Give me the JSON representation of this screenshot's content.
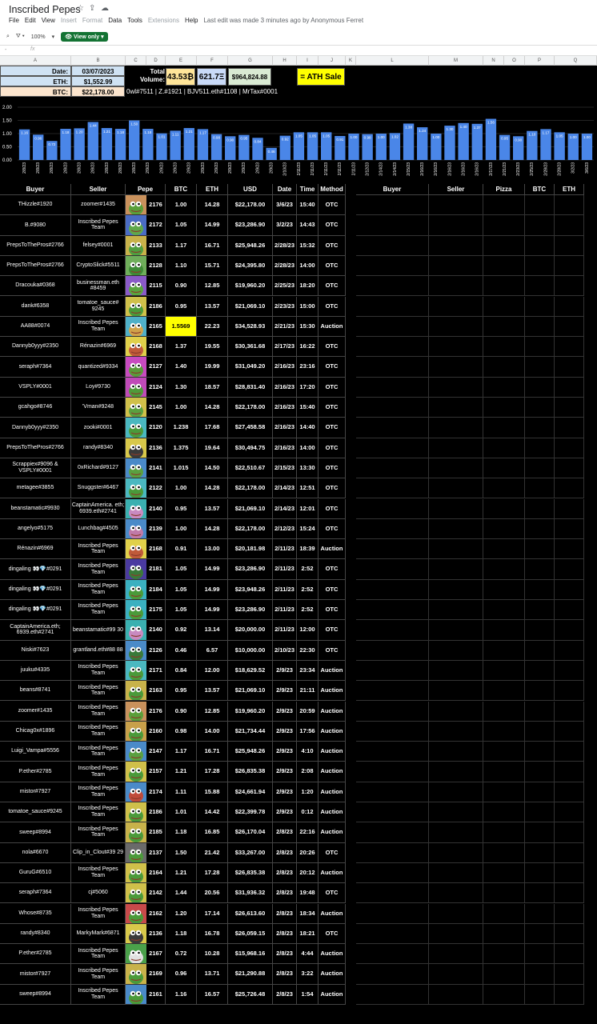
{
  "app": {
    "title": "Inscribed Pepes",
    "menus": [
      "File",
      "Edit",
      "View",
      "Insert",
      "Format",
      "Data",
      "Tools",
      "Extensions",
      "Help"
    ],
    "disabled_menus": [
      "Insert",
      "Format",
      "Extensions"
    ],
    "last_edit": "Last edit was made 3 minutes ago by Anonymous Ferret",
    "zoom": "100%",
    "view_only_label": "View only",
    "fx_label": "fx",
    "cell_ref": "-"
  },
  "columns": [
    "A",
    "B",
    "C",
    "D",
    "E",
    "F",
    "G",
    "H",
    "I",
    "J",
    "K",
    "L",
    "M",
    "N",
    "O",
    "P",
    "Q"
  ],
  "summary": {
    "date_label": "Date:",
    "date_value": "03/07/2023",
    "eth_label": "ETH:",
    "eth_value": "$1,552.99",
    "btc_label": "BTC:",
    "btc_value": "$22,178.00",
    "total_label": "Total Volume:",
    "total_btc": "43.53₿",
    "total_eth": "621.7Ξ",
    "total_usd": "$964,824.88",
    "ath_label": "= ATH Sale",
    "credits": "0wl#7511 | Z.#1921 | BJV511.eth#1108 | MrTax#0001",
    "colors": {
      "date_bg": "#cfe2f3",
      "btc_bg": "#fce5cd",
      "total_btc_bg": "#ffe599",
      "total_eth_bg": "#c9daf8",
      "total_usd_bg": "#d9ead3",
      "ath_bg": "#ffff00"
    }
  },
  "chart_data": {
    "type": "bar",
    "color": "#4a86e8",
    "ylim": [
      0,
      2.0
    ],
    "yticks": [
      "2.00",
      "1.50",
      "1.00",
      "0.50",
      "0.00"
    ],
    "categories": [
      "2/8/23",
      "2/8/23",
      "2/8/23",
      "2/8/23",
      "2/8/23",
      "2/8/23",
      "2/8/23",
      "2/8/23",
      "2/8/23",
      "2/9/23",
      "2/9/23",
      "2/9/23",
      "2/9/23",
      "2/9/23",
      "2/9/23",
      "2/9/23",
      "2/9/23",
      "2/9/23",
      "2/9/23",
      "2/10/23",
      "2/11/23",
      "2/11/23",
      "2/11/23",
      "2/11/23",
      "2/11/23",
      "2/12/23",
      "2/14/23",
      "2/14/23",
      "2/15/23",
      "2/16/23",
      "2/16/23",
      "2/16/23",
      "2/16/23",
      "2/16/23",
      "2/17/23",
      "2/21/23",
      "2/23/23",
      "2/25/23",
      "2/28/23",
      "2/28/23",
      "3/2/23",
      "3/6/23"
    ],
    "values": [
      1.16,
      0.96,
      0.72,
      1.18,
      1.2,
      1.44,
      1.21,
      1.18,
      1.5,
      1.18,
      1.01,
      1.11,
      1.21,
      1.17,
      0.98,
      0.9,
      0.95,
      0.84,
      0.46,
      0.92,
      1.05,
      1.05,
      1.05,
      0.91,
      1.0,
      0.98,
      1.0,
      1.02,
      1.38,
      1.24,
      1.0,
      1.3,
      1.4,
      1.37,
      1.56,
      0.95,
      0.9,
      1.1,
      1.17,
      1.05,
      1.0,
      1.0
    ],
    "labels": [
      "1.16",
      "0.96",
      "0.72",
      "1.18",
      "1.20",
      "1.44",
      "1.21",
      "1.18",
      "1.50",
      "1.18",
      "1.01",
      "1.11",
      "1.21",
      "1.17",
      "0.98",
      "0.90",
      "0.95",
      "0.84",
      "0.46",
      "0.92",
      "1.05",
      "1.05",
      "1.05",
      "0.91",
      "1.00",
      "0.98",
      "1.00",
      "1.02",
      "1.38",
      "1.24",
      "1.00",
      "1.30",
      "1.40",
      "1.37",
      "1.56",
      "0.95",
      "0.90",
      "1.10",
      "1.17",
      "1.05",
      "1.00",
      "1.00"
    ]
  },
  "table": {
    "headers": [
      "Buyer",
      "Seller",
      "Pepe",
      "BTC",
      "ETH",
      "USD",
      "Date",
      "Time",
      "Method"
    ],
    "right_headers": [
      "Buyer",
      "Seller",
      "Pizza",
      "BTC",
      "ETH"
    ],
    "rows": [
      {
        "buyer": "THizzle#1920",
        "seller": "zoomer#1435",
        "pepe": "2176",
        "btc": "1.00",
        "eth": "14.28",
        "usd": "$22,178.00",
        "date": "3/6/23",
        "time": "15:40",
        "method": "OTC",
        "bg": "#c9915c",
        "fg": "#5a9f3a"
      },
      {
        "buyer": "B.#9080",
        "seller": "Inscribed Pepes Team",
        "pepe": "2172",
        "btc": "1.05",
        "eth": "14.99",
        "usd": "$23,286.90",
        "date": "3/2/23",
        "time": "14:43",
        "method": "OTC",
        "bg": "#4a6cc4",
        "fg": "#5fa84a"
      },
      {
        "buyer": "PrepsToThePros#2766",
        "seller": "felsey#0001",
        "pepe": "2133",
        "btc": "1.17",
        "eth": "16.71",
        "usd": "$25,948.26",
        "date": "2/28/23",
        "time": "15:32",
        "method": "OTC",
        "bg": "#c8b24a",
        "fg": "#4f9e3f"
      },
      {
        "buyer": "PrepsToThePros#2766",
        "seller": "CryptoSlick#5511",
        "pepe": "2128",
        "btc": "1.10",
        "eth": "15.71",
        "usd": "$24,395.80",
        "date": "2/28/23",
        "time": "14:00",
        "method": "OTC",
        "bg": "#6fae5a",
        "fg": "#3e8a36"
      },
      {
        "buyer": "Dracouka#0368",
        "seller": "businessman.eth #8459",
        "pepe": "2115",
        "btc": "0.90",
        "eth": "12.85",
        "usd": "$19,960.20",
        "date": "2/25/23",
        "time": "18:20",
        "method": "OTC",
        "bg": "#8a5ac8",
        "fg": "#59a43f"
      },
      {
        "buyer": "dank#6358",
        "seller": "tomatoe_sauce# 9245",
        "pepe": "2186",
        "btc": "0.95",
        "eth": "13.57",
        "usd": "$21,069.10",
        "date": "2/23/23",
        "time": "15:00",
        "method": "OTC",
        "bg": "#cfc04a",
        "fg": "#4a9a3a"
      },
      {
        "buyer": "AA88#0074",
        "seller": "Inscribed Pepes Team",
        "pepe": "2165",
        "btc": "1.5569",
        "eth": "22.23",
        "usd": "$34,528.93",
        "date": "2/21/23",
        "time": "15:30",
        "method": "Auction",
        "bg": "#4fb0c8",
        "fg": "#d0a24a",
        "ath": true
      },
      {
        "buyer": "Dannyb0yyy#2350",
        "seller": "Rénazin#6969",
        "pepe": "2168",
        "btc": "1.37",
        "eth": "19.55",
        "usd": "$30,361.68",
        "date": "2/17/23",
        "time": "16:22",
        "method": "OTC",
        "bg": "#e0d04a",
        "fg": "#c05a3a"
      },
      {
        "buyer": "seraph#7364",
        "seller": "quantized#9334",
        "pepe": "2127",
        "btc": "1.40",
        "eth": "19.99",
        "usd": "$31,049.20",
        "date": "2/16/23",
        "time": "23:16",
        "method": "OTC",
        "bg": "#c84ac0",
        "fg": "#5a9a3a"
      },
      {
        "buyer": "VSPLY#0001",
        "seller": "Loy#9730",
        "pepe": "2124",
        "btc": "1.30",
        "eth": "18.57",
        "usd": "$28,831.40",
        "date": "2/16/23",
        "time": "17:20",
        "method": "OTC",
        "bg": "#c04ab8",
        "fg": "#4f9a3a"
      },
      {
        "buyer": "gcahgo#8746",
        "seller": "'Vman#9248",
        "pepe": "2145",
        "btc": "1.00",
        "eth": "14.28",
        "usd": "$22,178.00",
        "date": "2/16/23",
        "time": "15:40",
        "method": "OTC",
        "bg": "#d0c04a",
        "fg": "#5aa040"
      },
      {
        "buyer": "Dannyb0yyy#2350",
        "seller": "zooki#0001",
        "pepe": "2120",
        "btc": "1.238",
        "eth": "17.68",
        "usd": "$27,458.58",
        "date": "2/16/23",
        "time": "14:40",
        "method": "OTC",
        "bg": "#4ab8c0",
        "fg": "#4a9a3a"
      },
      {
        "buyer": "PrepsToThePros#2766",
        "seller": "randy#8340",
        "pepe": "2136",
        "btc": "1.375",
        "eth": "19.64",
        "usd": "$30,494.75",
        "date": "2/16/23",
        "time": "14:00",
        "method": "OTC",
        "bg": "#d8c84a",
        "fg": "#3a3a3a"
      },
      {
        "buyer": "Scrappiex#9096 & VSPLY#0001",
        "seller": "0xRichard#9127",
        "pepe": "2141",
        "btc": "1.015",
        "eth": "14.50",
        "usd": "$22,510.67",
        "date": "2/15/23",
        "time": "13:30",
        "method": "OTC",
        "bg": "#4a8ac8",
        "fg": "#5aa040"
      },
      {
        "buyer": "metagee#3855",
        "seller": "Snuggster#6467",
        "pepe": "2122",
        "btc": "1.00",
        "eth": "14.28",
        "usd": "$22,178.00",
        "date": "2/14/23",
        "time": "12:51",
        "method": "OTC",
        "bg": "#4ab8c0",
        "fg": "#4a9a3a"
      },
      {
        "buyer": "beanstamatic#9930",
        "seller": "CaptainAmerica. eth; 6939.eth#2741",
        "pepe": "2140",
        "btc": "0.95",
        "eth": "13.57",
        "usd": "$21,069.10",
        "date": "2/14/23",
        "time": "12:01",
        "method": "OTC",
        "bg": "#3ab0b0",
        "fg": "#c88ac0"
      },
      {
        "buyer": "angelyo#5175",
        "seller": "Lunchbag#4505",
        "pepe": "2139",
        "btc": "1.00",
        "eth": "14.28",
        "usd": "$22,178.00",
        "date": "2/12/23",
        "time": "15:24",
        "method": "OTC",
        "bg": "#4a8ac8",
        "fg": "#c07aa8"
      },
      {
        "buyer": "Rénazin#6969",
        "seller": "Inscribed Pepes Team",
        "pepe": "2168",
        "btc": "0.91",
        "eth": "13.00",
        "usd": "$20,181.98",
        "date": "2/11/23",
        "time": "18:39",
        "method": "Auction",
        "bg": "#e0d04a",
        "fg": "#c05a3a"
      },
      {
        "buyer": "dingaling 👀💎#0291",
        "seller": "Inscribed Pepes Team",
        "pepe": "2181",
        "btc": "1.05",
        "eth": "14.99",
        "usd": "$23,286.90",
        "date": "2/11/23",
        "time": "2:52",
        "method": "OTC",
        "bg": "#4a3aa0",
        "fg": "#3a7a3a"
      },
      {
        "buyer": "dingaling 👀💎#0291",
        "seller": "Inscribed Pepes Team",
        "pepe": "2184",
        "btc": "1.05",
        "eth": "14.99",
        "usd": "$23,948.26",
        "date": "2/11/23",
        "time": "2:52",
        "method": "OTC",
        "bg": "#3ab0c0",
        "fg": "#4a9a3a"
      },
      {
        "buyer": "dingaling 👀💎#0291",
        "seller": "Inscribed Pepes Team",
        "pepe": "2175",
        "btc": "1.05",
        "eth": "14.99",
        "usd": "$23,286.90",
        "date": "2/11/23",
        "time": "2:52",
        "method": "OTC",
        "bg": "#3ab0c0",
        "fg": "#4a9a3a"
      },
      {
        "buyer": "CaptainAmerica.eth; 6939.eth#2741",
        "seller": "beanstamatic#99 30",
        "pepe": "2140",
        "btc": "0.92",
        "eth": "13.14",
        "usd": "$20,000.00",
        "date": "2/11/23",
        "time": "12:00",
        "method": "OTC",
        "bg": "#3ab0b0",
        "fg": "#c88ac0"
      },
      {
        "buyer": "Niski#7623",
        "seller": "grantland.eth#88 88",
        "pepe": "2126",
        "btc": "0.46",
        "eth": "6.57",
        "usd": "$10,000.00",
        "date": "2/10/23",
        "time": "22:30",
        "method": "OTC",
        "bg": "#4a8ac8",
        "fg": "#3a7a3a"
      },
      {
        "buyer": "juuku#4335",
        "seller": "Inscribed Pepes Team",
        "pepe": "2171",
        "btc": "0.84",
        "eth": "12.00",
        "usd": "$18,629.52",
        "date": "2/9/23",
        "time": "23:34",
        "method": "Auction",
        "bg": "#4ab8c0",
        "fg": "#4a9a3a"
      },
      {
        "buyer": "beans#8741",
        "seller": "Inscribed Pepes Team",
        "pepe": "2163",
        "btc": "0.95",
        "eth": "13.57",
        "usd": "$21,069.10",
        "date": "2/9/23",
        "time": "21:11",
        "method": "Auction",
        "bg": "#c8b24a",
        "fg": "#4a9a3a"
      },
      {
        "buyer": "zoomer#1435",
        "seller": "Inscribed Pepes Team",
        "pepe": "2176",
        "btc": "0.90",
        "eth": "12.85",
        "usd": "$19,960.20",
        "date": "2/9/23",
        "time": "20:59",
        "method": "Auction",
        "bg": "#c9915c",
        "fg": "#5a9f3a"
      },
      {
        "buyer": "Chicag0x#1896",
        "seller": "Inscribed Pepes Team",
        "pepe": "2160",
        "btc": "0.98",
        "eth": "14.00",
        "usd": "$21,734.44",
        "date": "2/9/23",
        "time": "17:56",
        "method": "Auction",
        "bg": "#c8a04a",
        "fg": "#4a9a3a"
      },
      {
        "buyer": "Luigi_Vampa#5556",
        "seller": "Inscribed Pepes Team",
        "pepe": "2147",
        "btc": "1.17",
        "eth": "16.71",
        "usd": "$25,948.26",
        "date": "2/9/23",
        "time": "4:10",
        "method": "Auction",
        "bg": "#4a8ac8",
        "fg": "#5aa040"
      },
      {
        "buyer": "P.ether#2785",
        "seller": "Inscribed Pepes Team",
        "pepe": "2157",
        "btc": "1.21",
        "eth": "17.28",
        "usd": "$26,835.38",
        "date": "2/9/23",
        "time": "2:08",
        "method": "Auction",
        "bg": "#d0c04a",
        "fg": "#4a9a3a"
      },
      {
        "buyer": "mistor#7927",
        "seller": "Inscribed Pepes Team",
        "pepe": "2174",
        "btc": "1.11",
        "eth": "15.88",
        "usd": "$24,661.94",
        "date": "2/9/23",
        "time": "1:20",
        "method": "Auction",
        "bg": "#4a8ac8",
        "fg": "#c04a3a"
      },
      {
        "buyer": "tomatoe_sauce#9245",
        "seller": "Inscribed Pepes Team",
        "pepe": "2186",
        "btc": "1.01",
        "eth": "14.42",
        "usd": "$22,399.78",
        "date": "2/9/23",
        "time": "0:12",
        "method": "Auction",
        "bg": "#cfc04a",
        "fg": "#4a9a3a"
      },
      {
        "buyer": "sweep#8994",
        "seller": "Inscribed Pepes Team",
        "pepe": "2185",
        "btc": "1.18",
        "eth": "16.85",
        "usd": "$26,170.04",
        "date": "2/8/23",
        "time": "22:16",
        "method": "Auction",
        "bg": "#c8b24a",
        "fg": "#4a9a3a"
      },
      {
        "buyer": "nola#6670",
        "seller": "Clip_in_Clout#39 29",
        "pepe": "2137",
        "btc": "1.50",
        "eth": "21.42",
        "usd": "$33,267.00",
        "date": "2/8/23",
        "time": "20:26",
        "method": "OTC",
        "bg": "#6a6a6a",
        "fg": "#4a9a3a"
      },
      {
        "buyer": "GuruG#6510",
        "seller": "Inscribed Pepes Team",
        "pepe": "2164",
        "btc": "1.21",
        "eth": "17.28",
        "usd": "$26,835.38",
        "date": "2/8/23",
        "time": "20:12",
        "method": "Auction",
        "bg": "#d0c04a",
        "fg": "#4a9a3a"
      },
      {
        "buyer": "seraph#7364",
        "seller": "cj#5060",
        "pepe": "2142",
        "btc": "1.44",
        "eth": "20.56",
        "usd": "$31,936.32",
        "date": "2/8/23",
        "time": "19:48",
        "method": "OTC",
        "bg": "#d0c04a",
        "fg": "#4a9a3a"
      },
      {
        "buyer": "Whose#8735",
        "seller": "Inscribed Pepes Team",
        "pepe": "2162",
        "btc": "1.20",
        "eth": "17.14",
        "usd": "$26,613.60",
        "date": "2/8/23",
        "time": "18:34",
        "method": "Auction",
        "bg": "#c84a4a",
        "fg": "#4a9a3a"
      },
      {
        "buyer": "randy#8340",
        "seller": "MarkyMark#6871",
        "pepe": "2136",
        "btc": "1.18",
        "eth": "16.78",
        "usd": "$26,059.15",
        "date": "2/8/23",
        "time": "18:21",
        "method": "OTC",
        "bg": "#d8c84a",
        "fg": "#3a3a3a"
      },
      {
        "buyer": "P.ether#2785",
        "seller": "Inscribed Pepes Team",
        "pepe": "2167",
        "btc": "0.72",
        "eth": "10.28",
        "usd": "$15,968.16",
        "date": "2/8/23",
        "time": "4:44",
        "method": "Auction",
        "bg": "#4aa04a",
        "fg": "#e0e0e0"
      },
      {
        "buyer": "mistor#7927",
        "seller": "Inscribed Pepes Team",
        "pepe": "2169",
        "btc": "0.96",
        "eth": "13.71",
        "usd": "$21,290.88",
        "date": "2/8/23",
        "time": "3:22",
        "method": "Auction",
        "bg": "#c8b24a",
        "fg": "#4a9a3a"
      },
      {
        "buyer": "sweep#8994",
        "seller": "Inscribed Pepes Team",
        "pepe": "2161",
        "btc": "1.16",
        "eth": "16.57",
        "usd": "$25,726.48",
        "date": "2/8/23",
        "time": "1:54",
        "method": "Auction",
        "bg": "#4a8ac8",
        "fg": "#4a9a3a"
      }
    ]
  }
}
